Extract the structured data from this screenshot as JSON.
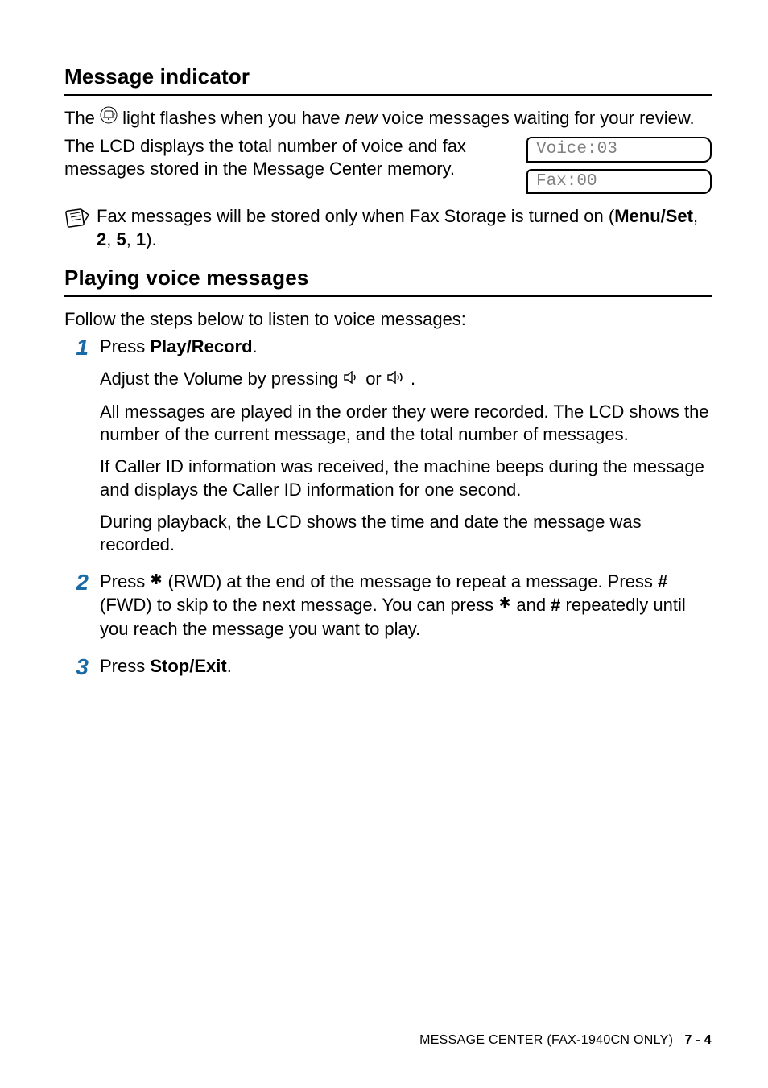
{
  "section1": {
    "heading": "Message indicator",
    "p1_pre": "The ",
    "p1_post": " light flashes when you have ",
    "p1_ital": "new",
    "p1_end": " voice messages waiting for your review.",
    "p2": "The LCD displays the total number of voice and fax messages stored in the Message Center memory.",
    "lcd1": "Voice:03",
    "lcd2": "Fax:00",
    "note_pre": "Fax messages will be stored only when Fax Storage is turned on (",
    "note_b1": "Menu/Set",
    "note_mid1": ", ",
    "note_b2": "2",
    "note_mid2": ", ",
    "note_b3": "5",
    "note_mid3": ", ",
    "note_b4": "1",
    "note_post": ")."
  },
  "section2": {
    "heading": "Playing voice messages",
    "intro": "Follow the steps below to listen to voice messages:",
    "steps": {
      "s1": {
        "num": "1",
        "l1_pre": "Press ",
        "l1_b": "Play/Record",
        "l1_post": ".",
        "l2_pre": "Adjust the Volume by pressing  ",
        "l2_mid": "  or  ",
        "l2_post": " .",
        "l3": "All messages are played in the order they were recorded. The LCD shows the number of the current message, and the total number of messages.",
        "l4": "If Caller ID information was received, the machine beeps during the message and displays the Caller ID information for one second.",
        "l5": "During playback, the LCD shows the time and date the message was recorded."
      },
      "s2": {
        "num": "2",
        "t1": "Press ",
        "star": " ",
        "t2": " (RWD) at the end of the message to repeat a message. Press ",
        "hash": "#",
        "t3": " (FWD) to skip to the next message. You can press ",
        "t4": " and ",
        "t5": " repeatedly until you reach the message you want to play."
      },
      "s3": {
        "num": "3",
        "pre": "Press ",
        "b": "Stop/Exit",
        "post": "."
      }
    }
  },
  "footer": {
    "label": "MESSAGE CENTER (FAX-1940CN ONLY)",
    "page": "7 - 4"
  }
}
